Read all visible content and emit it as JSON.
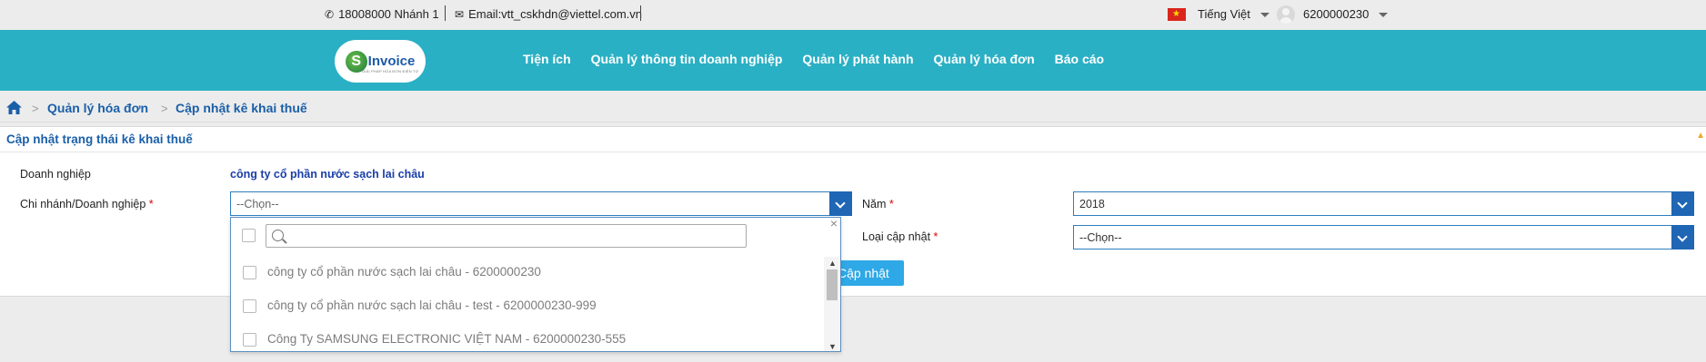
{
  "topbar": {
    "phone": "18008000 Nhánh 1",
    "email": "Email:vtt_cskhdn@viettel.com.vn",
    "language": "Tiếng Việt",
    "user": "6200000230"
  },
  "header": {
    "logo_letter": "S",
    "logo_text": "Invoice",
    "logo_sub": "GIẢI PHÁP HÓA ĐƠN ĐIỆN TỬ",
    "nav": [
      "Tiện ích",
      "Quản lý thông tin doanh nghiệp",
      "Quản lý phát hành",
      "Quản lý hóa đơn",
      "Báo cáo"
    ]
  },
  "breadcrumb": {
    "items": [
      "Quản lý hóa đơn",
      "Cập nhật kê khai thuế"
    ]
  },
  "panel": {
    "title": "Cập nhật trạng thái kê khai thuế",
    "company_label": "Doanh nghiệp",
    "company_value": "công ty cổ phần nước sạch lai châu",
    "branch_label": "Chi nhánh/Doanh nghiệp",
    "branch_value": "--Chọn--",
    "year_label": "Năm",
    "year_value": "2018",
    "type_label": "Loại cập nhật",
    "type_value": "--Chọn--",
    "required_mark": "*",
    "update_button": "Cập nhật"
  },
  "dropdown": {
    "search_placeholder": "",
    "options": [
      "công ty cổ phần nước sạch lai châu - 6200000230",
      "công ty cổ phần nước sạch lai châu - test - 6200000230-999",
      "Công Ty SAMSUNG ELECTRONIC VIỆT NAM - 6200000230-555"
    ]
  },
  "colors": {
    "header_bg": "#2ab0c4",
    "link_blue": "#1a5fa8",
    "select_button": "#1f66b5",
    "update_button": "#2ea8e6"
  }
}
